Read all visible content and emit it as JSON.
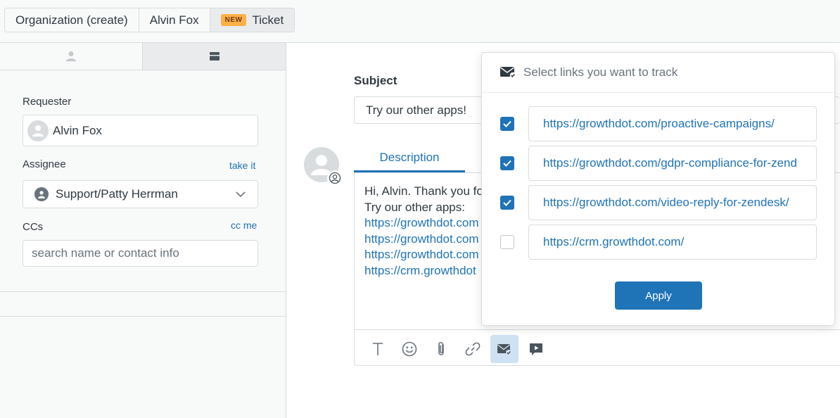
{
  "tabs": [
    {
      "label": "Organization (create)"
    },
    {
      "label": "Alvin Fox"
    },
    {
      "label": "Ticket",
      "badge": "NEW"
    }
  ],
  "sidebar": {
    "requester_label": "Requester",
    "requester_value": "Alvin Fox",
    "assignee_label": "Assignee",
    "take_it": "take it",
    "assignee_value": "Support/Patty Herrman",
    "ccs_label": "CCs",
    "cc_me": "cc me",
    "ccs_placeholder": "search name or contact info"
  },
  "main": {
    "subject_label": "Subject",
    "subject_value": "Try our other apps!",
    "description_tab": "Description",
    "body_lines": [
      "Hi, Alvin. Thank you fo",
      "Try our other apps:"
    ],
    "body_links": [
      "https://growthdot.com",
      "https://growthdot.com",
      "https://growthdot.com",
      "https://crm.growthdot"
    ]
  },
  "popover": {
    "title": "Select links you want to track",
    "links": [
      {
        "url": "https://growthdot.com/proactive-campaigns/",
        "checked": true
      },
      {
        "url": "https://growthdot.com/gdpr-compliance-for-zend",
        "checked": true
      },
      {
        "url": "https://growthdot.com/video-reply-for-zendesk/",
        "checked": true
      },
      {
        "url": "https://crm.growthdot.com/",
        "checked": false
      }
    ],
    "apply_label": "Apply"
  },
  "colors": {
    "accent": "#1f73b7",
    "badge": "#fcb046",
    "border": "#d8dcde",
    "sidebar_bg": "#f8f9f9"
  },
  "toolbar_icons": [
    "text-format-icon",
    "emoji-icon",
    "attachment-icon",
    "link-icon",
    "tracked-email-icon",
    "video-icon"
  ]
}
